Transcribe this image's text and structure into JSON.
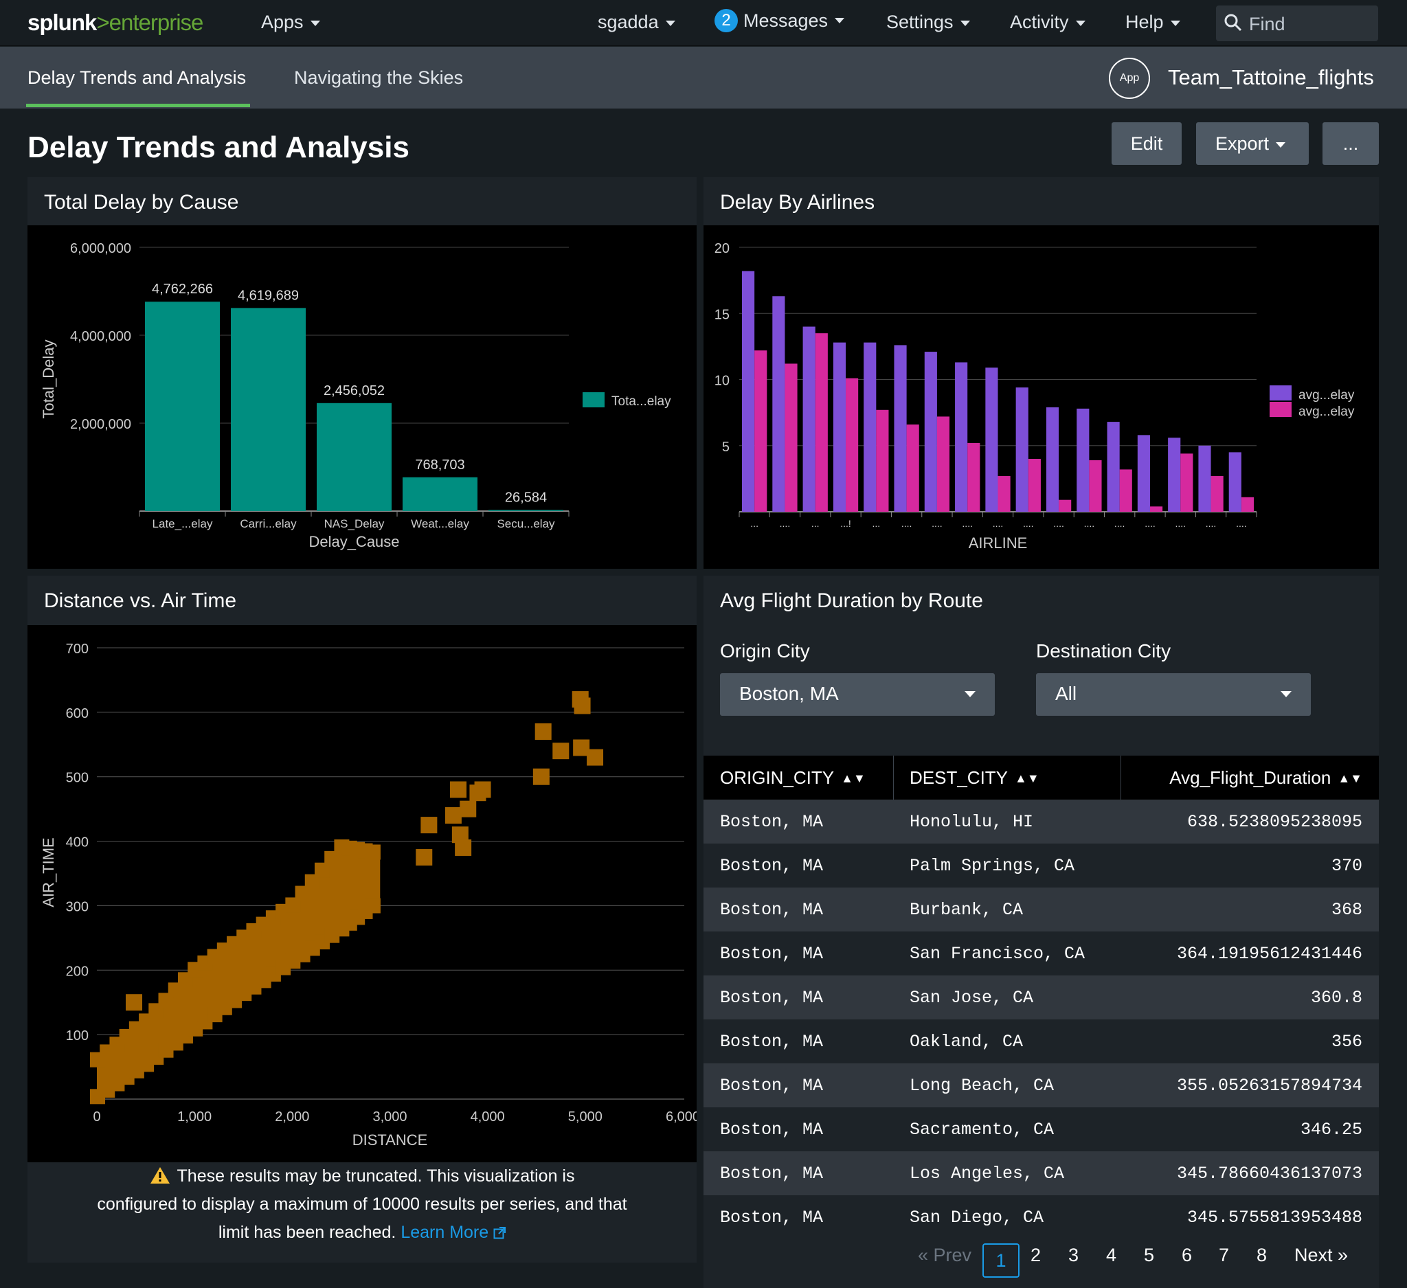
{
  "topbar": {
    "logo_a": "splunk",
    "logo_b": ">",
    "logo_c": "enterprise",
    "apps": "Apps",
    "user": "sgadda",
    "messages_count": "2",
    "messages": "Messages",
    "settings": "Settings",
    "activity": "Activity",
    "help": "Help",
    "find_placeholder": "Find"
  },
  "appbar": {
    "tabs": [
      "Delay Trends and Analysis",
      "Navigating the Skies"
    ],
    "app_icon_label": "App",
    "app_name": "Team_Tattoine_flights"
  },
  "page": {
    "title": "Delay Trends and Analysis",
    "edit": "Edit",
    "export": "Export",
    "more": "..."
  },
  "colors": {
    "teal": "#008e80",
    "purple": "#7e4fd8",
    "pink": "#d6299e",
    "brown": "#a56400",
    "link": "#1a9be6",
    "splunk_green": "#65a637"
  },
  "panels": {
    "p1_title": "Total Delay by Cause",
    "p2_title": "Delay By Airlines",
    "p3_title": "Distance vs. Air Time",
    "p4_title": "Avg Flight Duration by Route"
  },
  "chart_data": [
    {
      "type": "bar",
      "title": "Total Delay by Cause",
      "categories": [
        "Late_...elay",
        "Carri...elay",
        "NAS_Delay",
        "Weat...elay",
        "Secu...elay"
      ],
      "values": [
        4762266,
        4619689,
        2456052,
        768703,
        26584
      ],
      "value_labels": [
        "4,762,266",
        "4,619,689",
        "2,456,052",
        "768,703",
        "26,584"
      ],
      "xlabel": "Delay_Cause",
      "ylabel": "Total_Delay",
      "ylim": [
        0,
        6000000
      ],
      "yticks": [
        "2,000,000",
        "4,000,000",
        "6,000,000"
      ],
      "legend": [
        "Tota...elay"
      ],
      "legend_position": "right",
      "grid": true
    },
    {
      "type": "bar",
      "title": "Delay By Airlines",
      "xlabel": "AIRLINE",
      "ylabel": "",
      "ylim": [
        0,
        20
      ],
      "yticks": [
        "5",
        "10",
        "15",
        "20"
      ],
      "categories": [
        "...",
        "....",
        "...",
        "...!",
        "...",
        "....",
        "....",
        "....",
        "....",
        "....",
        "....",
        "....",
        "....",
        "....",
        "....",
        "....",
        "...."
      ],
      "series": [
        {
          "name": "avg...elay",
          "values": [
            18.2,
            16.3,
            14.0,
            12.8,
            12.8,
            12.6,
            12.1,
            11.3,
            10.9,
            9.4,
            7.9,
            7.8,
            6.8,
            5.8,
            5.6,
            5.0,
            4.5
          ]
        },
        {
          "name": "avg...elay",
          "values": [
            12.2,
            11.2,
            13.5,
            10.1,
            7.7,
            6.6,
            7.2,
            5.2,
            2.7,
            4.0,
            0.9,
            3.9,
            3.2,
            0.4,
            4.4,
            2.7,
            1.1
          ]
        }
      ],
      "legend_position": "right",
      "grid": true
    },
    {
      "type": "scatter",
      "title": "Distance vs. Air Time",
      "xlabel": "DISTANCE",
      "ylabel": "AIR_TIME",
      "xlim": [
        0,
        6000
      ],
      "ylim": [
        0,
        700
      ],
      "xticks": [
        "0",
        "1,000",
        "2,000",
        "3,000",
        "4,000",
        "5,000",
        "6,000"
      ],
      "yticks": [
        "100",
        "200",
        "300",
        "400",
        "500",
        "600",
        "700"
      ],
      "band": {
        "x_from": 0,
        "x_to": 2900,
        "lower": [
          [
            0,
            5
          ],
          [
            500,
            55
          ],
          [
            1000,
            110
          ],
          [
            1500,
            165
          ],
          [
            2000,
            215
          ],
          [
            2500,
            265
          ],
          [
            2900,
            310
          ]
        ],
        "upper": [
          [
            0,
            60
          ],
          [
            500,
            120
          ],
          [
            1000,
            200
          ],
          [
            1500,
            250
          ],
          [
            2000,
            300
          ],
          [
            2500,
            390
          ],
          [
            2900,
            380
          ]
        ]
      },
      "outliers": [
        [
          380,
          150
        ],
        [
          3400,
          425
        ],
        [
          3350,
          375
        ],
        [
          3700,
          480
        ],
        [
          3650,
          440
        ],
        [
          3800,
          450
        ],
        [
          3720,
          410
        ],
        [
          3750,
          390
        ],
        [
          3900,
          475
        ],
        [
          3950,
          480
        ],
        [
          4550,
          500
        ],
        [
          4570,
          570
        ],
        [
          4750,
          540
        ],
        [
          4950,
          620
        ],
        [
          4970,
          610
        ],
        [
          4960,
          545
        ],
        [
          5100,
          530
        ]
      ],
      "grid": true
    },
    {
      "type": "table",
      "title": "Avg Flight Duration by Route",
      "columns": [
        "ORIGIN_CITY",
        "DEST_CITY",
        "Avg_Flight_Duration"
      ],
      "rows": [
        [
          "Boston, MA",
          "Honolulu, HI",
          "638.5238095238095"
        ],
        [
          "Boston, MA",
          "Palm Springs, CA",
          "370"
        ],
        [
          "Boston, MA",
          "Burbank, CA",
          "368"
        ],
        [
          "Boston, MA",
          "San Francisco, CA",
          "364.19195612431446"
        ],
        [
          "Boston, MA",
          "San Jose, CA",
          "360.8"
        ],
        [
          "Boston, MA",
          "Oakland, CA",
          "356"
        ],
        [
          "Boston, MA",
          "Long Beach, CA",
          "355.05263157894734"
        ],
        [
          "Boston, MA",
          "Sacramento, CA",
          "346.25"
        ],
        [
          "Boston, MA",
          "Los Angeles, CA",
          "345.78660436137073"
        ],
        [
          "Boston, MA",
          "San Diego, CA",
          "345.5755813953488"
        ]
      ]
    }
  ],
  "filters": {
    "origin_label": "Origin City",
    "origin_value": "Boston, MA",
    "dest_label": "Destination City",
    "dest_value": "All"
  },
  "warning": {
    "line1": "These results may be truncated. This visualization is",
    "line2": "configured to display a maximum of 10000 results per series, and that",
    "line3": "limit has been reached.",
    "link": "Learn More"
  },
  "pagination": {
    "prev": "« Prev",
    "pages": [
      "1",
      "2",
      "3",
      "4",
      "5",
      "6",
      "7",
      "8"
    ],
    "current": "1",
    "next": "Next »"
  }
}
